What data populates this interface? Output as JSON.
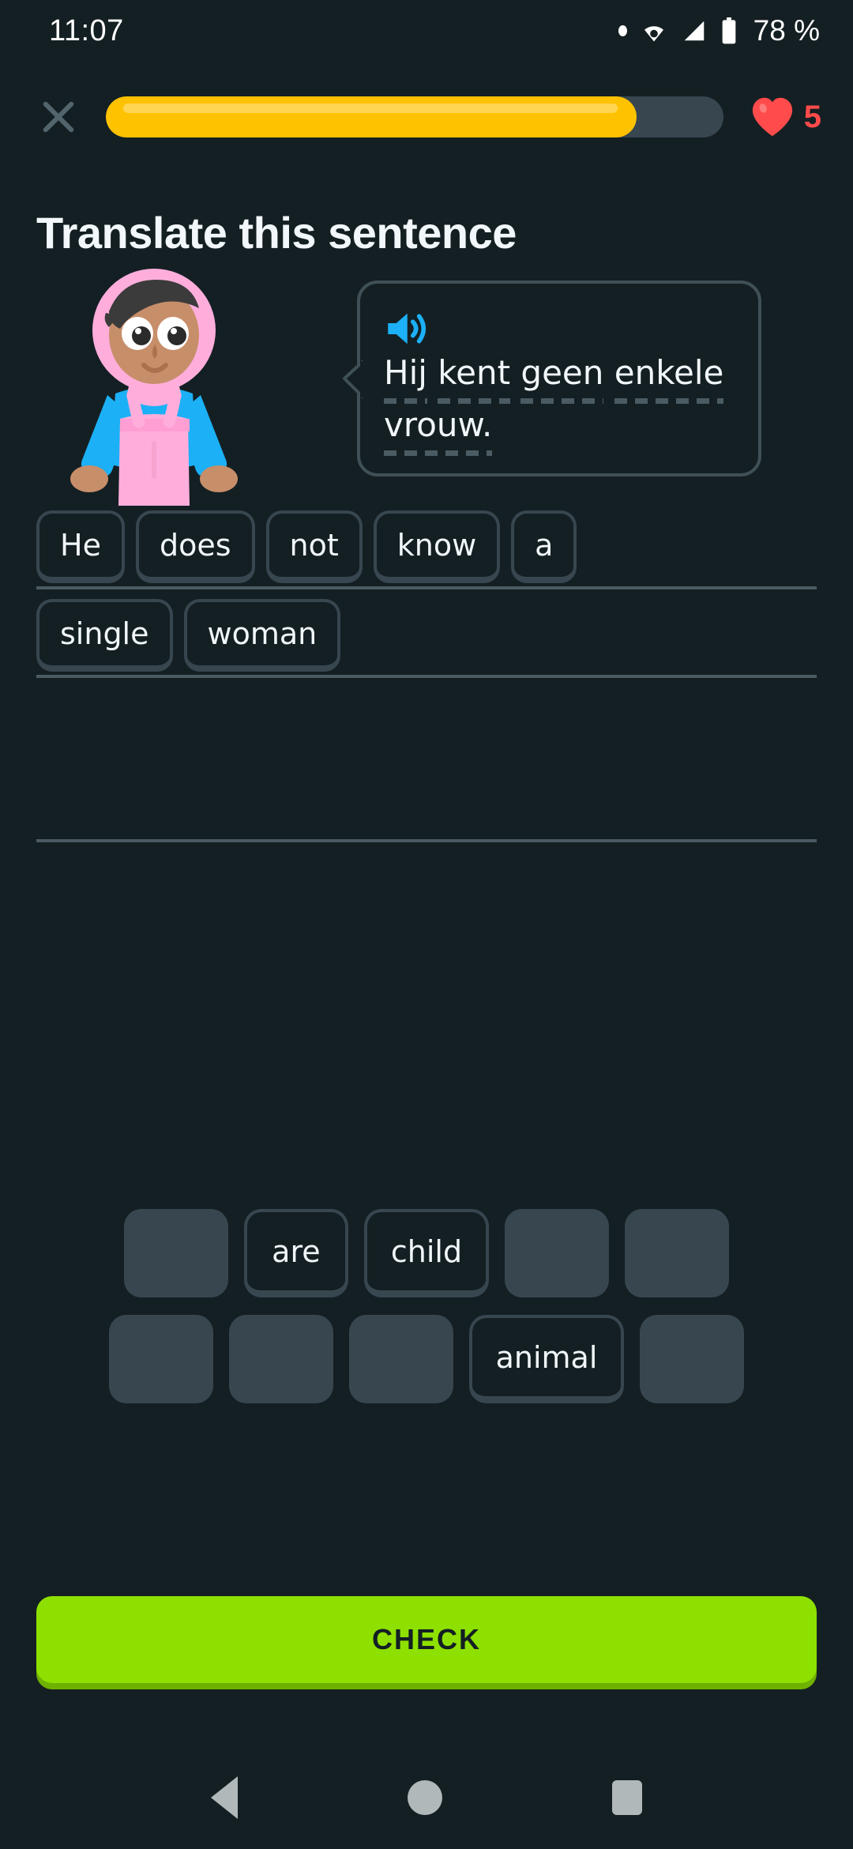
{
  "status_bar": {
    "time": "11:07",
    "battery_text": "78 %",
    "icons": [
      "dot-icon",
      "wifi-icon",
      "signal-icon",
      "battery-icon"
    ]
  },
  "header": {
    "close_icon": "close-icon",
    "progress_percent": 86,
    "hearts_icon": "heart-icon",
    "hearts_count": "5",
    "progress_fill_color": "#ffc200",
    "progress_track_color": "#37464f",
    "heart_color": "#ff4b4b"
  },
  "page_title": "Translate this sentence",
  "prompt": {
    "character": "zari-character",
    "speaker_icon": "speaker-icon",
    "speaker_icon_color": "#1cb0f6",
    "sentence": "Hij kent geen enkele vrouw.",
    "words": [
      "Hij",
      "kent",
      "geen",
      "enkele",
      "vrouw."
    ]
  },
  "answer": {
    "rows": [
      {
        "tiles": [
          "He",
          "does",
          "not",
          "know",
          "a"
        ]
      },
      {
        "tiles": [
          "single",
          "woman"
        ]
      },
      {
        "tiles": []
      }
    ]
  },
  "word_bank": {
    "rows": [
      [
        {
          "label": "",
          "used": true
        },
        {
          "label": "are",
          "used": false
        },
        {
          "label": "child",
          "used": false
        },
        {
          "label": "",
          "used": true
        },
        {
          "label": "",
          "used": true
        }
      ],
      [
        {
          "label": "",
          "used": true
        },
        {
          "label": "",
          "used": true
        },
        {
          "label": "",
          "used": true
        },
        {
          "label": "animal",
          "used": false
        },
        {
          "label": "",
          "used": true
        }
      ]
    ]
  },
  "check_button": {
    "label": "CHECK",
    "color": "#8ee000",
    "text_color": "#131f24"
  },
  "nav_bar": {
    "back_icon": "back-triangle-icon",
    "home_icon": "home-circle-icon",
    "recents_icon": "recents-square-icon"
  }
}
